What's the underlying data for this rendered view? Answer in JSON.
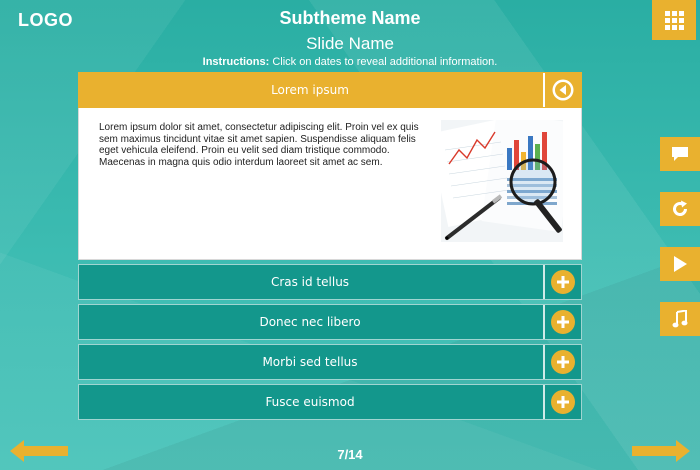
{
  "header": {
    "logo": "LOGO",
    "subtheme": "Subtheme Name",
    "slide_name": "Slide Name",
    "instructions_label": "Instructions:",
    "instructions_text": " Click on dates to reveal additional information."
  },
  "accordion": {
    "open_item": {
      "title": "Lorem ipsum",
      "body": "Lorem ipsum dolor sit amet, consectetur adipiscing elit. Proin vel ex quis sem maximus tincidunt vitae sit amet sapien. Suspendisse aliquam felis eget vehicula eleifend. Proin eu velit sed diam tristique commodo. Maecenas in magna quis odio interdum laoreet sit amet ac sem."
    },
    "items": [
      {
        "title": "Cras id tellus"
      },
      {
        "title": "Donec nec libero"
      },
      {
        "title": "Morbi sed tellus"
      },
      {
        "title": "Fusce euismod"
      }
    ]
  },
  "side_buttons": [
    "comment-icon",
    "replay-icon",
    "play-icon",
    "music-icon"
  ],
  "pagination": {
    "current": "7/14"
  },
  "colors": {
    "accent": "#e9b12f",
    "teal_row": "#13978c",
    "background": "#2fb3a8"
  }
}
